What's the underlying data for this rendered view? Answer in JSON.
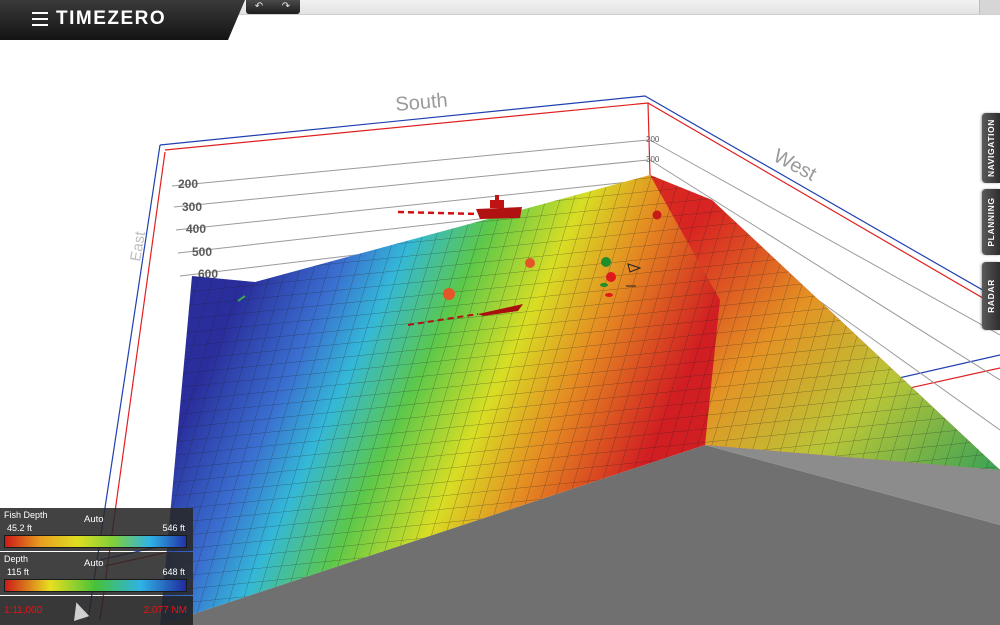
{
  "app": {
    "brand": "TIMEZERO"
  },
  "toolbar": {
    "undo_glyph": "↶",
    "redo_glyph": "↷"
  },
  "side_tabs": [
    {
      "label": "NAVIGATION"
    },
    {
      "label": "PLANNING"
    },
    {
      "label": "RADAR"
    }
  ],
  "scene": {
    "label_south": "South",
    "label_west": "West",
    "label_east": "East",
    "depth_ticks_left": [
      "200",
      "300",
      "400",
      "500",
      "600"
    ],
    "depth_ticks_right": [
      "200",
      "300"
    ]
  },
  "legend_fish": {
    "title": "Fish Depth",
    "mode": "Auto",
    "min": "45.2 ft",
    "max": "546 ft",
    "colors": [
      "#cc1a1a",
      "#e8a020",
      "#dede20",
      "#7fcf3a",
      "#2fb3e6",
      "#2233a8"
    ]
  },
  "legend_depth": {
    "title": "Depth",
    "mode": "Auto",
    "min": "115 ft",
    "max": "648 ft",
    "colors": [
      "#cc1a1a",
      "#e8e020",
      "#46c23a",
      "#2fb3e6",
      "#202a9e"
    ]
  },
  "scale": {
    "scale_text": "1:11,000",
    "distance_text": "2.077 NM"
  },
  "colors": {
    "axis_red": "#e02020",
    "axis_blue": "#2040b0",
    "vessel": "#b01212"
  }
}
